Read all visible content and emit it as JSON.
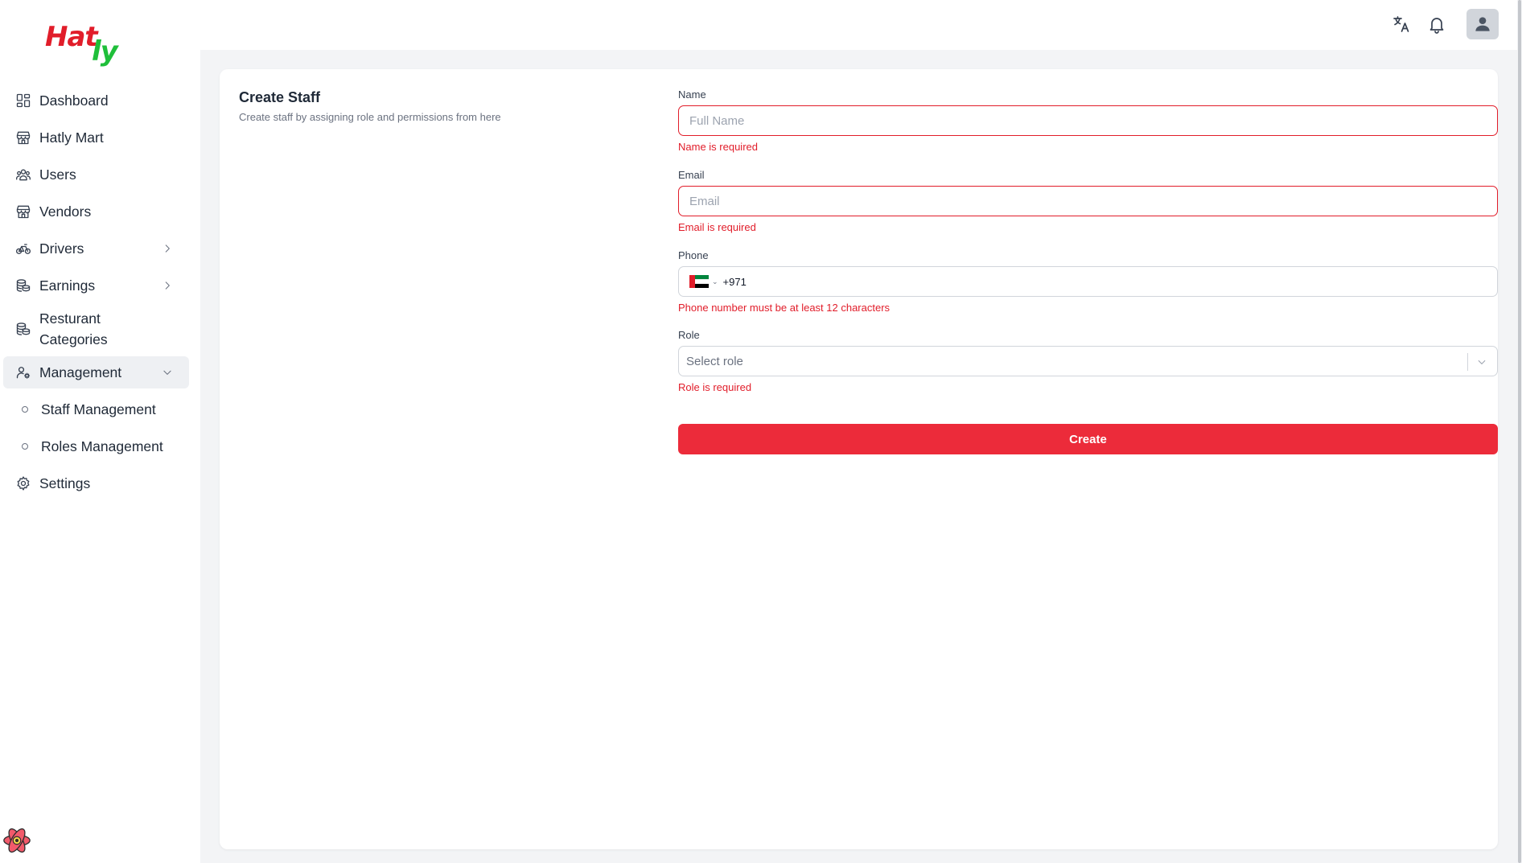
{
  "brand": {
    "logo_part1": "Hat",
    "logo_part2": "ly",
    "color1": "#e11d2a",
    "color2": "#1fbf3a"
  },
  "sidebar": {
    "items": [
      {
        "label": "Dashboard",
        "icon": "dashboard-grid-icon"
      },
      {
        "label": "Hatly Mart",
        "icon": "store-icon"
      },
      {
        "label": "Users",
        "icon": "users-icon"
      },
      {
        "label": "Vendors",
        "icon": "store-icon"
      },
      {
        "label": "Drivers",
        "icon": "bicycle-icon",
        "expandable": true
      },
      {
        "label": "Earnings",
        "icon": "coins-icon",
        "expandable": true
      },
      {
        "label": "Resturant Categories",
        "icon": "coins-icon"
      },
      {
        "label": "Management",
        "icon": "user-gear-icon",
        "expanded": true,
        "active": true
      },
      {
        "label": "Settings",
        "icon": "gear-icon"
      }
    ],
    "management_sub": [
      {
        "label": "Staff Management"
      },
      {
        "label": "Roles Management"
      }
    ],
    "resturant_line1": "Resturant",
    "resturant_line2": "Categories"
  },
  "topbar": {
    "icons": [
      "translate-icon",
      "bell-icon",
      "user-avatar-icon"
    ]
  },
  "page": {
    "title": "Create Staff",
    "subtitle": "Create staff by assigning role and permissions from here"
  },
  "form": {
    "name": {
      "label": "Name",
      "placeholder": "Full Name",
      "value": "",
      "error": "Name is required"
    },
    "email": {
      "label": "Email",
      "placeholder": "Email",
      "value": "",
      "error": "Email is required"
    },
    "phone": {
      "label": "Phone",
      "country": "AE",
      "code": "+971",
      "error": "Phone number must be at least 12 characters"
    },
    "role": {
      "label": "Role",
      "placeholder": "Select role",
      "error": "Role is required"
    },
    "submit_label": "Create"
  },
  "colors": {
    "accent": "#ec2b3a",
    "error": "#e11d2a",
    "background": "#f3f4f6"
  }
}
